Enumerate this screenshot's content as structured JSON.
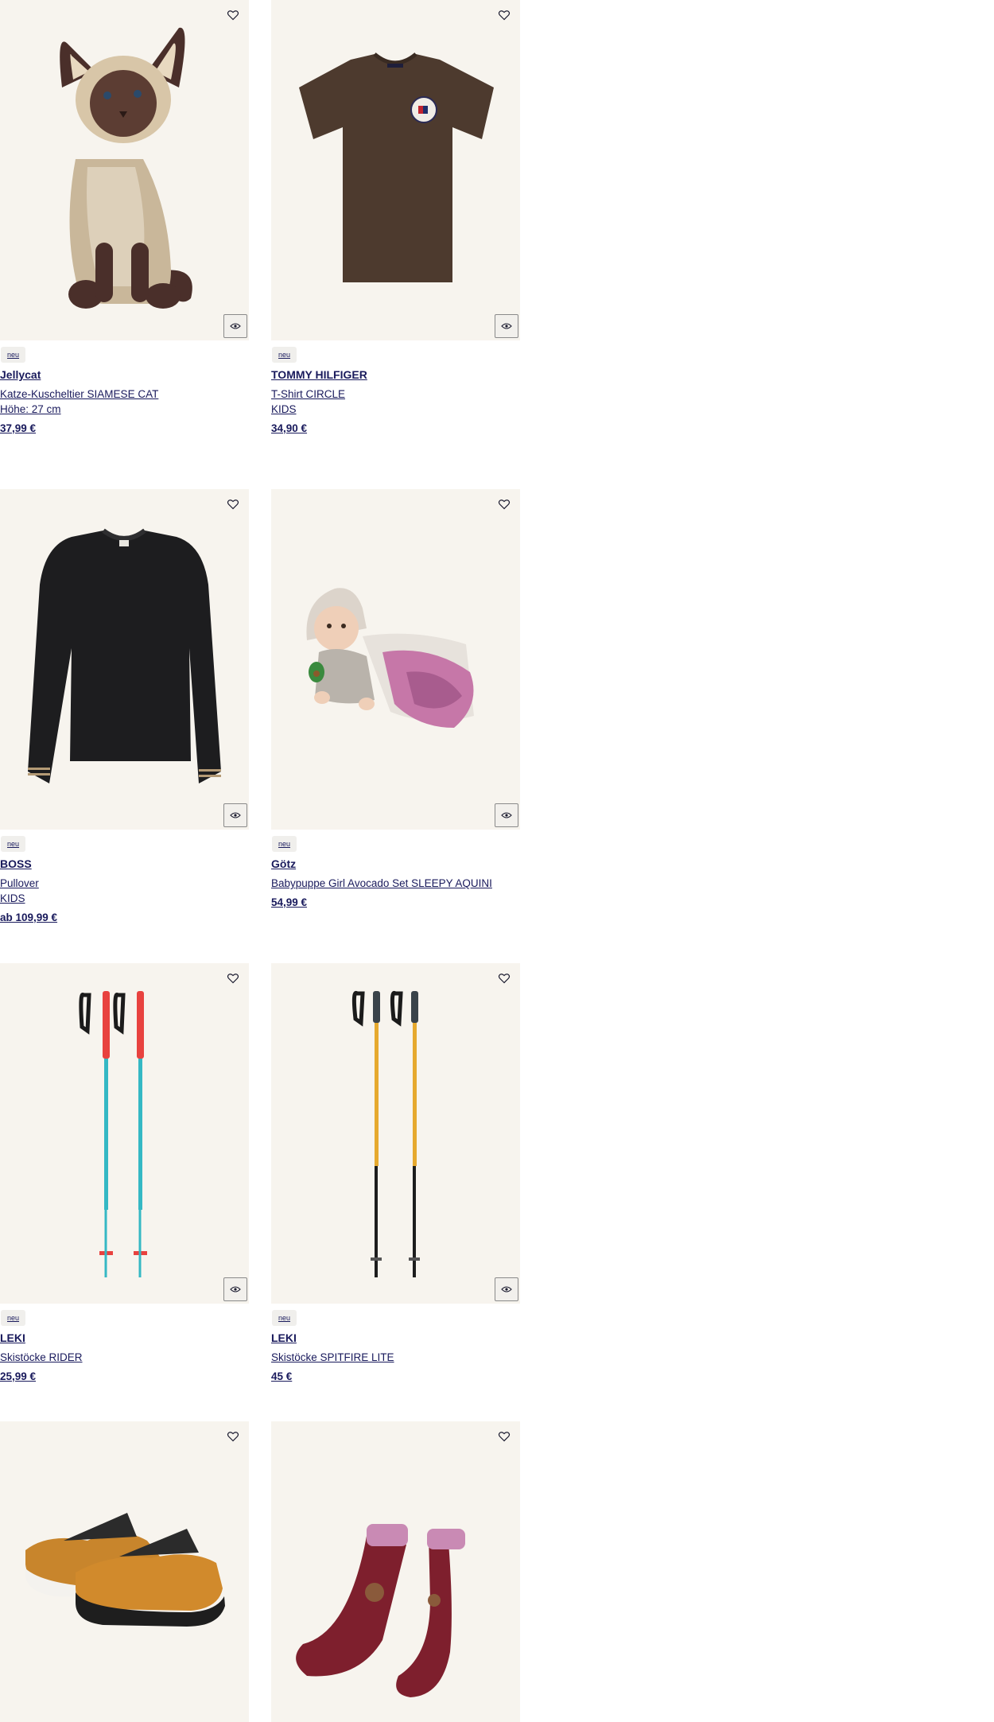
{
  "products": [
    {
      "icon": "plush-cat-image",
      "badge": "neu",
      "brand": "Jellycat",
      "lines": [
        "Katze-Kuscheltier SIAMESE CAT",
        "Höhe: 27 cm"
      ],
      "price": "37,99 €"
    },
    {
      "icon": "tshirt-image",
      "badge": "neu",
      "brand": "TOMMY HILFIGER",
      "lines": [
        "T-Shirt CIRCLE",
        "KIDS"
      ],
      "price": "34,90 €"
    },
    {
      "icon": "sweater-image",
      "badge": "neu",
      "brand": "BOSS",
      "lines": [
        "Pullover",
        "KIDS"
      ],
      "price": "ab 109,99 €"
    },
    {
      "icon": "baby-doll-image",
      "badge": "neu",
      "brand": "Götz",
      "lines": [
        "Babypuppe Girl Avocado Set SLEEPY AQUINI"
      ],
      "price": "54,99 €"
    },
    {
      "icon": "ski-poles-red-image",
      "badge": "neu",
      "brand": "LEKI",
      "lines": [
        "Skistöcke RIDER"
      ],
      "price": "25,99 €"
    },
    {
      "icon": "ski-poles-black-image",
      "badge": "neu",
      "brand": "LEKI",
      "lines": [
        "Skistöcke SPITFIRE LITE"
      ],
      "price": "45 €"
    },
    {
      "icon": "sneakers-image",
      "badge": "",
      "brand": "",
      "lines": [],
      "price": ""
    },
    {
      "icon": "socks-image",
      "badge": "",
      "brand": "",
      "lines": [],
      "price": ""
    }
  ],
  "colors": {
    "text": "#191a5c",
    "image_background": "#f7f4ee"
  }
}
